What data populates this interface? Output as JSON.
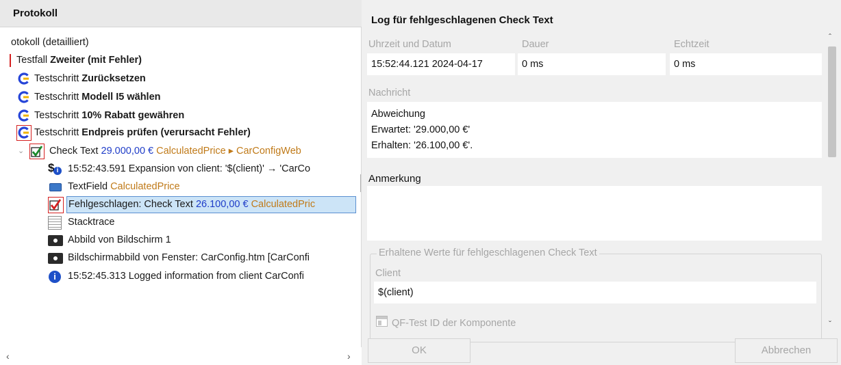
{
  "left": {
    "title": "Protokoll",
    "tree": [
      {
        "text": "otokoll (detailliert)"
      },
      {
        "prefix": "Testfall ",
        "bold": "Zweiter (mit Fehler)"
      },
      {
        "prefix": "Testschritt ",
        "bold": "Zurücksetzen"
      },
      {
        "prefix": "Testschritt ",
        "bold": "Modell I5 wählen"
      },
      {
        "prefix": "Testschritt ",
        "bold": "10% Rabatt gewähren"
      },
      {
        "prefix": "Testschritt ",
        "bold": "Endpreis prüfen (verursacht Fehler)"
      },
      {
        "prefix": "Check Text ",
        "value": "29.000,00 €",
        "comp": "CalculatedPrice ▸ CarConfigWeb"
      },
      {
        "text": "15:52:43.591 Expansion von client: '$(client)' → 'CarCo"
      },
      {
        "prefix": "TextField ",
        "comp": "CalculatedPrice"
      },
      {
        "prefix": "Fehlgeschlagen: Check Text ",
        "value": "26.100,00 €",
        "comp": "CalculatedPric"
      },
      {
        "text": "Stacktrace"
      },
      {
        "text": "Abbild von Bildschirm 1"
      },
      {
        "text": "Bildschirmabbild von Fenster: CarConfig.htm [CarConfi"
      },
      {
        "text": "15:52:45.313 Logged information from client CarConfi"
      }
    ]
  },
  "right": {
    "title": "Log für fehlgeschlagenen Check Text",
    "datetime_label": "Uhrzeit und Datum",
    "datetime_value": "15:52:44.121  2024-04-17",
    "duration_label": "Dauer",
    "duration_value": "0 ms",
    "realtime_label": "Echtzeit",
    "realtime_value": "0 ms",
    "message_label": "Nachricht",
    "message_lines": [
      "Abweichung",
      "Erwartet: '29.000,00 €'",
      "Erhalten: '26.100,00 €'."
    ],
    "note_label": "Anmerkung",
    "received_group": "Erhaltene Werte für fehlgeschlagenen Check Text",
    "client_label": "Client",
    "client_value": "$(client)",
    "qfid_label": "QF-Test ID der Komponente",
    "ok_label": "OK",
    "cancel_label": "Abbrechen"
  },
  "colors": {
    "value_blue": "#1e3cc8",
    "component_orange": "#c07a18",
    "selection": "#cce4f7",
    "error_red": "#d42020",
    "check_green": "#1a8a2a"
  }
}
